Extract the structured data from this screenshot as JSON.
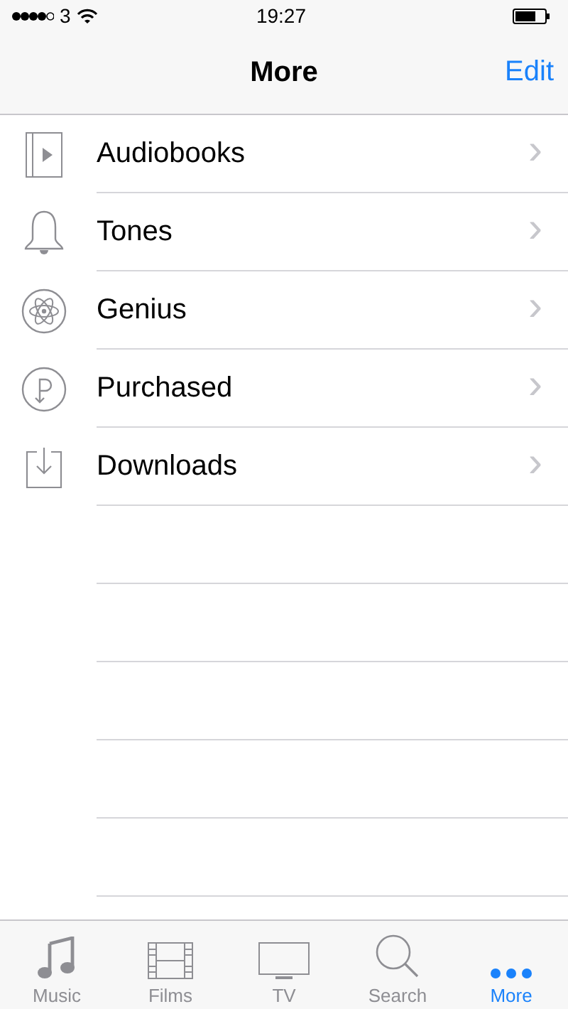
{
  "status_bar": {
    "carrier": "3",
    "time": "19:27"
  },
  "nav_bar": {
    "title": "More",
    "action": "Edit"
  },
  "items": [
    {
      "label": "Audiobooks",
      "chevron": "›"
    },
    {
      "label": "Tones",
      "chevron": "›"
    },
    {
      "label": "Genius",
      "chevron": "›"
    },
    {
      "label": "Purchased",
      "chevron": "›"
    },
    {
      "label": "Downloads",
      "chevron": "›"
    }
  ],
  "tab_bar": [
    {
      "label": "Music",
      "selected": false
    },
    {
      "label": "Films",
      "selected": false
    },
    {
      "label": "TV",
      "selected": false
    },
    {
      "label": "Search",
      "selected": false
    },
    {
      "label": "More",
      "selected": true
    }
  ]
}
